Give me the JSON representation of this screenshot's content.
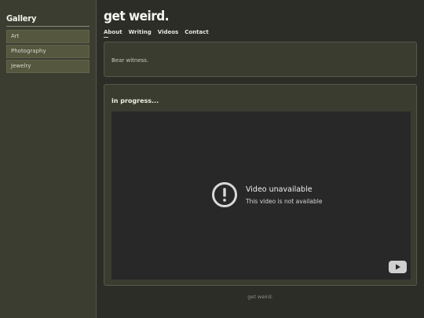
{
  "sidebar": {
    "title": "Gallery",
    "items": [
      {
        "label": "Art"
      },
      {
        "label": "Photography"
      },
      {
        "label": "Jewelry"
      }
    ]
  },
  "header": {
    "title": "get weird.",
    "nav": [
      {
        "label": "About"
      },
      {
        "label": "Writing"
      },
      {
        "label": "Videos"
      },
      {
        "label": "Contact"
      }
    ]
  },
  "intro": {
    "text": "Bear witness."
  },
  "video_section": {
    "heading": "in progress...",
    "player": {
      "title": "Video unavailable",
      "subtitle": "This video is not available",
      "status_icon": "exclamation-circle-icon",
      "brand_icon": "youtube-icon"
    }
  },
  "footer": {
    "text": "get weird."
  },
  "colors": {
    "page_bg": "#2d2d28",
    "sidebar_bg": "#3c3d31",
    "card_bg": "#3b3c30",
    "video_bg": "#282828"
  }
}
